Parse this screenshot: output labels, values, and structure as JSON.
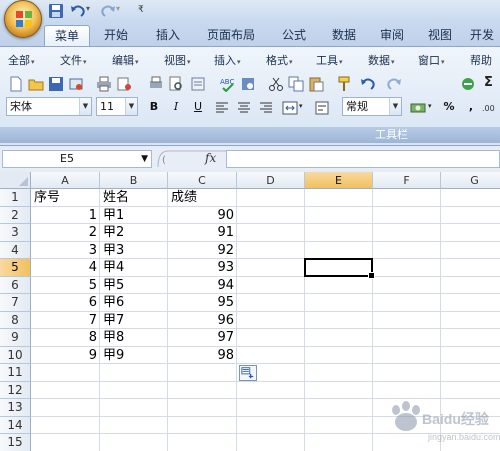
{
  "quick_access": {
    "icons": [
      "office-logo-icon",
      "save-icon",
      "undo-icon",
      "redo-icon",
      "customize-dropdown-icon"
    ]
  },
  "tabs": [
    {
      "label": "菜单",
      "active": true
    },
    {
      "label": "开始",
      "active": false
    },
    {
      "label": "插入",
      "active": false
    },
    {
      "label": "页面布局",
      "active": false
    },
    {
      "label": "公式",
      "active": false
    },
    {
      "label": "数据",
      "active": false
    },
    {
      "label": "审阅",
      "active": false
    },
    {
      "label": "视图",
      "active": false
    },
    {
      "label": "开发",
      "active": false
    }
  ],
  "menu": [
    {
      "label": "全部"
    },
    {
      "label": "文件"
    },
    {
      "label": "编辑"
    },
    {
      "label": "视图"
    },
    {
      "label": "插入"
    },
    {
      "label": "格式"
    },
    {
      "label": "工具"
    },
    {
      "label": "数据"
    },
    {
      "label": "窗口"
    },
    {
      "label": "帮助"
    }
  ],
  "format_bar": {
    "font_name": "宋体",
    "font_size": "11",
    "bold": "B",
    "italic": "I",
    "underline": "U",
    "number_format": "常规",
    "percent": "%",
    "comma": ",",
    "sigma": "Σ"
  },
  "toolbar_label": "工具栏",
  "formula_bar": {
    "name_box": "E5",
    "fx": "fx",
    "formula": ""
  },
  "grid": {
    "columns": [
      "A",
      "B",
      "C",
      "D",
      "E",
      "F",
      "G"
    ],
    "active_column": "E",
    "active_row": "5",
    "rows": [
      "1",
      "2",
      "3",
      "4",
      "5",
      "6",
      "7",
      "8",
      "9",
      "10",
      "11",
      "12",
      "13",
      "14",
      "15"
    ],
    "header_row": [
      "序号",
      "姓名",
      "成绩"
    ],
    "data": [
      {
        "seq": "1",
        "name": "甲1",
        "score": "90"
      },
      {
        "seq": "2",
        "name": "甲2",
        "score": "91"
      },
      {
        "seq": "3",
        "name": "甲3",
        "score": "92"
      },
      {
        "seq": "4",
        "name": "甲4",
        "score": "93"
      },
      {
        "seq": "5",
        "name": "甲5",
        "score": "94"
      },
      {
        "seq": "6",
        "name": "甲6",
        "score": "95"
      },
      {
        "seq": "7",
        "name": "甲7",
        "score": "96"
      },
      {
        "seq": "8",
        "name": "甲8",
        "score": "97"
      },
      {
        "seq": "9",
        "name": "甲9",
        "score": "98"
      }
    ]
  },
  "watermark": {
    "brand": "Baidu经验",
    "url": "jingyan.baidu.com"
  }
}
